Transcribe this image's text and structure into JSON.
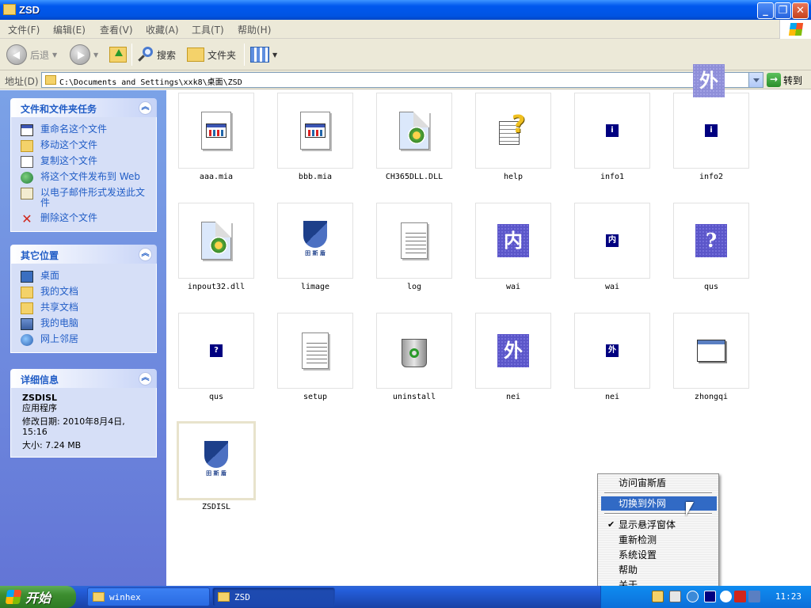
{
  "window": {
    "title": "ZSD"
  },
  "menubar": [
    {
      "label": "文件(F)"
    },
    {
      "label": "编辑(E)"
    },
    {
      "label": "查看(V)"
    },
    {
      "label": "收藏(A)"
    },
    {
      "label": "工具(T)"
    },
    {
      "label": "帮助(H)"
    }
  ],
  "toolbar": {
    "back": "后退",
    "search": "搜索",
    "folders": "文件夹"
  },
  "address": {
    "label": "地址(D)",
    "value": "C:\\Documents and Settings\\xxk8\\桌面\\ZSD",
    "go": "转到"
  },
  "panels": {
    "tasks": {
      "title": "文件和文件夹任务",
      "items": [
        "重命名这个文件",
        "移动这个文件",
        "复制这个文件",
        "将这个文件发布到 Web",
        "以电子邮件形式发送此文件",
        "删除这个文件"
      ]
    },
    "places": {
      "title": "其它位置",
      "items": [
        "桌面",
        "我的文档",
        "共享文档",
        "我的电脑",
        "网上邻居"
      ]
    },
    "details": {
      "title": "详细信息",
      "name": "ZSDISL",
      "type": "应用程序",
      "modified": "修改日期: 2010年8月4日, 15:16",
      "size": "大小: 7.24 MB"
    }
  },
  "files": [
    {
      "name": "aaa.mia",
      "icon": "document-window-icon"
    },
    {
      "name": "bbb.mia",
      "icon": "document-window-icon"
    },
    {
      "name": "CH365DLL.DLL",
      "icon": "dll-gear-icon"
    },
    {
      "name": "help",
      "icon": "help-icon"
    },
    {
      "name": "info1",
      "icon": "info-icon",
      "glyph": "i"
    },
    {
      "name": "info2",
      "icon": "info-icon",
      "glyph": "i"
    },
    {
      "name": "inpout32.dll",
      "icon": "dll-gear-icon"
    },
    {
      "name": "limage",
      "icon": "shield-logo-icon",
      "logo_text": "田 斯 盾"
    },
    {
      "name": "log",
      "icon": "notepad-icon"
    },
    {
      "name": "wai",
      "icon": "nei-large-icon",
      "glyph": "内"
    },
    {
      "name": "wai",
      "icon": "nei-small-icon",
      "glyph": "内"
    },
    {
      "name": "qus",
      "icon": "question-large-icon",
      "glyph": "?"
    },
    {
      "name": "qus",
      "icon": "question-small-icon",
      "glyph": "?"
    },
    {
      "name": "setup",
      "icon": "notepad-icon"
    },
    {
      "name": "uninstall",
      "icon": "recycle-bin-icon"
    },
    {
      "name": "nei",
      "icon": "wai-large-icon",
      "glyph": "外"
    },
    {
      "name": "nei",
      "icon": "wai-small-icon",
      "glyph": "外"
    },
    {
      "name": "zhongqi",
      "icon": "window-icon"
    },
    {
      "name": "ZSDISL",
      "icon": "shield-logo-icon",
      "logo_text": "田 斯 盾",
      "selected": true
    }
  ],
  "floating_window": {
    "glyph": "外"
  },
  "context_menu": {
    "items": [
      "访问宙斯盾",
      "切换到外网",
      "显示悬浮窗体",
      "重新检测",
      "系统设置",
      "帮助",
      "关于"
    ],
    "highlighted": "切换到外网",
    "checked": "显示悬浮窗体"
  },
  "taskbar": {
    "start": "开始",
    "tasks": [
      {
        "label": "winhex"
      },
      {
        "label": "ZSD"
      }
    ],
    "clock": "11:23"
  },
  "colors": {
    "title_blue": "#0054e3",
    "panel_bg": "#d6dff7",
    "link": "#215dc6",
    "menu_highlight": "#316ac5",
    "start_green": "#3c8d2f"
  }
}
